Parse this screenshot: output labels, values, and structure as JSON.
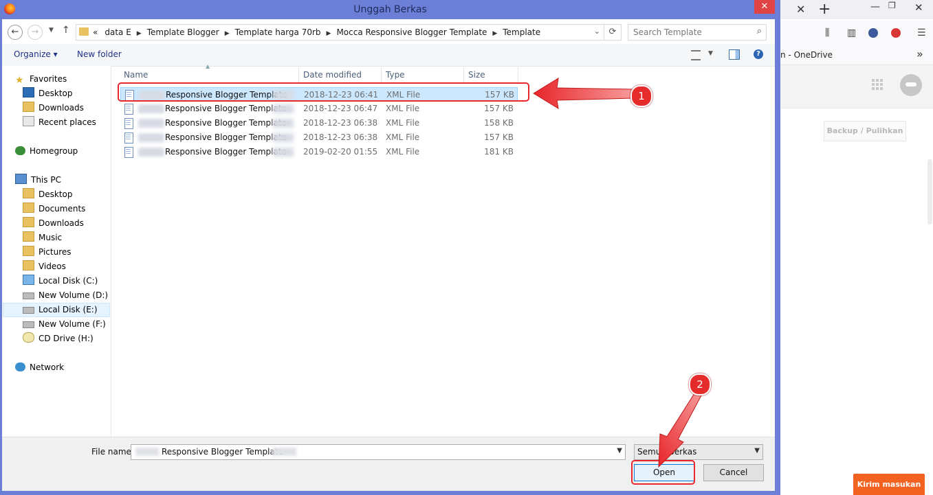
{
  "dialog": {
    "title": "Unggah Berkas",
    "close_label": "✕"
  },
  "navigation": {
    "back_label": "←",
    "forward_label": "→",
    "up_label": "↑",
    "breadcrumb_prefix": "«",
    "breadcrumbs": [
      "data E",
      "Template Blogger",
      "Template harga 70rb",
      "Mocca Responsive Blogger Template",
      "Template"
    ],
    "search_placeholder": "Search Template"
  },
  "toolbar": {
    "organize_label": "Organize ▾",
    "new_folder_label": "New folder"
  },
  "sidebar": {
    "favorites": "Favorites",
    "favorites_items": [
      "Desktop",
      "Downloads",
      "Recent places"
    ],
    "homegroup": "Homegroup",
    "this_pc": "This PC",
    "pc_items": [
      "Desktop",
      "Documents",
      "Downloads",
      "Music",
      "Pictures",
      "Videos",
      "Local Disk (C:)",
      "New Volume (D:)",
      "Local Disk (E:)",
      "New Volume (F:)",
      "CD Drive (H:)"
    ],
    "network": "Network",
    "selected": "Local Disk (E:)"
  },
  "file_list": {
    "columns": [
      "Name",
      "Date modified",
      "Type",
      "Size"
    ],
    "rows": [
      {
        "name": "Responsive Blogger Template",
        "date": "2018-12-23 06:41",
        "type": "XML File",
        "size": "157 KB",
        "selected": true
      },
      {
        "name": "Responsive Blogger Template",
        "date": "2018-12-23 06:47",
        "type": "XML File",
        "size": "157 KB",
        "selected": false
      },
      {
        "name": "Responsive Blogger Template",
        "date": "2018-12-23 06:38",
        "type": "XML File",
        "size": "158 KB",
        "selected": false
      },
      {
        "name": "Responsive Blogger Template",
        "date": "2018-12-23 06:38",
        "type": "XML File",
        "size": "157 KB",
        "selected": false
      },
      {
        "name": "Responsive Blogger Template",
        "date": "2019-02-20 01:55",
        "type": "XML File",
        "size": "181 KB",
        "selected": false
      }
    ]
  },
  "footer": {
    "file_name_label": "File name:",
    "file_name_value": "Responsive Blogger Template",
    "file_type_value": "Semua Berkas",
    "open_label": "Open",
    "cancel_label": "Cancel"
  },
  "annotations": {
    "step1": "1",
    "step2": "2",
    "color": "#e8262b"
  },
  "browser": {
    "tab_close": "✕",
    "new_tab": "+",
    "bookmark_text": "n - OneDrive",
    "backup_label": "Backup / Pulihkan",
    "feedback_label": "Kirim masukan",
    "feedback_color": "#f26322"
  }
}
